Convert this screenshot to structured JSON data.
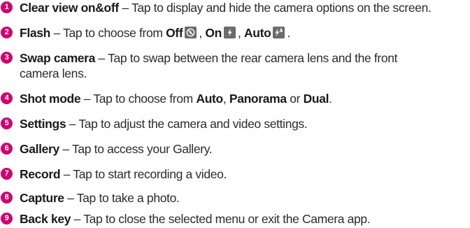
{
  "accent_color": "#d2006e",
  "icon_bg_color": "#6b6b6b",
  "items": [
    {
      "num": "1",
      "term": "Clear view on&off",
      "dash": " – ",
      "desc": "Tap to display and hide the camera options on the screen."
    },
    {
      "num": "2",
      "term": "Flash",
      "dash": " – ",
      "desc_pre": "Tap to choose from ",
      "opt1": "Off",
      "opt1_icon": "flash-off-icon",
      "sep1": ", ",
      "opt2": "On",
      "opt2_icon": "flash-on-icon",
      "sep2": ", ",
      "opt3": "Auto",
      "opt3_icon": "flash-auto-icon",
      "end": "."
    },
    {
      "num": "3",
      "term": "Swap camera",
      "dash": " – ",
      "desc_line1": "Tap to swap between the rear camera lens and the front",
      "desc_line2": "camera lens."
    },
    {
      "num": "4",
      "term": "Shot mode",
      "dash": " – ",
      "desc_pre": "Tap to choose from ",
      "opt1": "Auto",
      "sep1": ", ",
      "opt2": "Panorama",
      "sep2": " or ",
      "opt3": "Dual",
      "end": "."
    },
    {
      "num": "5",
      "term": "Settings",
      "dash": " – ",
      "desc": "Tap to adjust the camera and video settings."
    },
    {
      "num": "6",
      "term": "Gallery",
      "dash": " – ",
      "desc": "Tap to access your Gallery."
    },
    {
      "num": "7",
      "term": "Record",
      "dash": " – ",
      "desc": "Tap to start recording a video."
    },
    {
      "num": "8",
      "term": "Capture",
      "dash": " – ",
      "desc": "Tap to take a photo."
    },
    {
      "num": "9",
      "term": "Back key",
      "dash": " – ",
      "desc": "Tap to close the selected menu or exit the Camera app."
    }
  ]
}
